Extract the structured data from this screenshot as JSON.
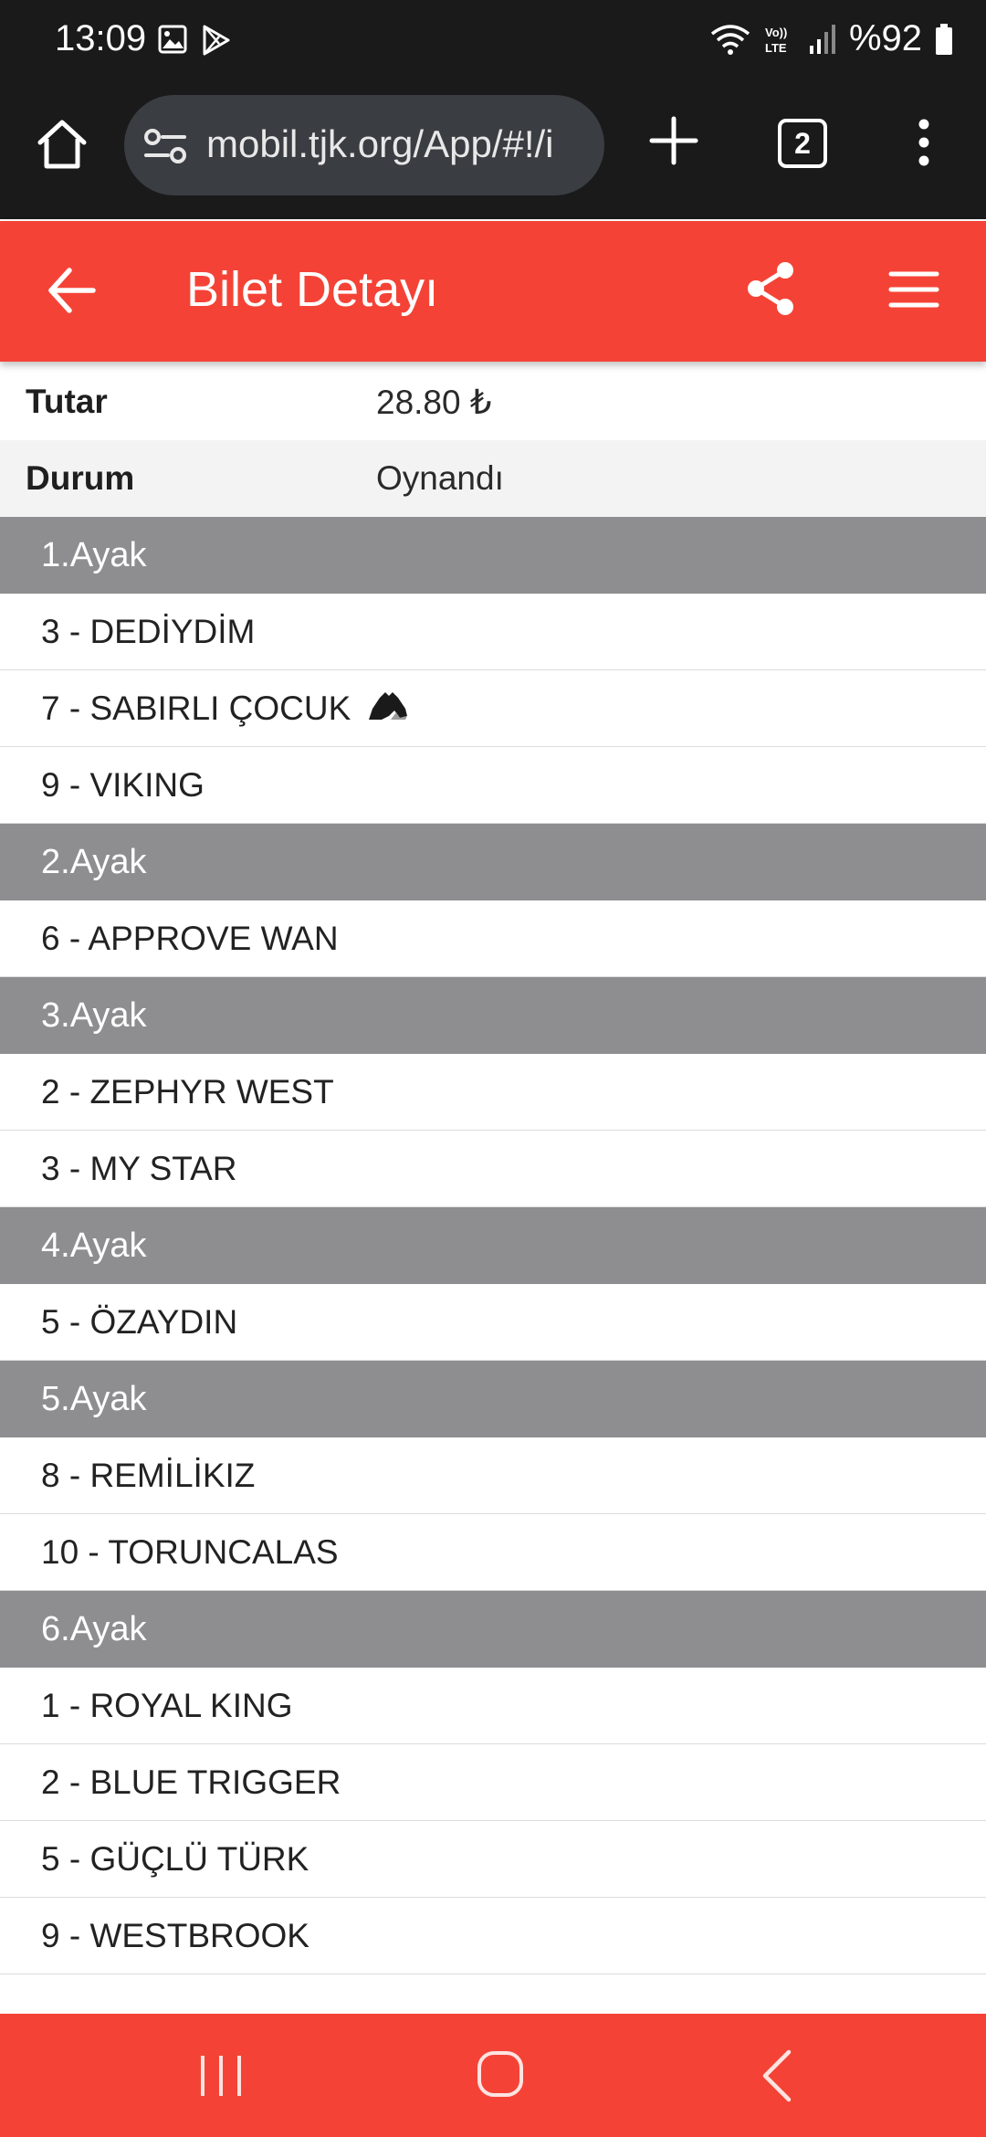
{
  "status_bar": {
    "time": "13:09",
    "battery": "%92"
  },
  "browser": {
    "url": "mobil.tjk.org/App/#!/i",
    "tab_count": "2"
  },
  "header": {
    "title": "Bilet Detayı"
  },
  "info": {
    "amount_label": "Tutar",
    "amount_value": "28.80 ₺",
    "status_label": "Durum",
    "status_value": "Oynandı"
  },
  "legs": [
    {
      "label": "1.Ayak",
      "horses": [
        "3 - DEDİYDİM",
        "7 - SABIRLI ÇOCUK",
        "9 - VIKING"
      ]
    },
    {
      "label": "2.Ayak",
      "horses": [
        "6 - APPROVE WAN"
      ]
    },
    {
      "label": "3.Ayak",
      "horses": [
        "2 - ZEPHYR WEST",
        "3 - MY STAR"
      ]
    },
    {
      "label": "4.Ayak",
      "horses": [
        "5 - ÖZAYDIN"
      ]
    },
    {
      "label": "5.Ayak",
      "horses": [
        "8 - REMİLİKIZ",
        "10 - TORUNCALAS"
      ]
    },
    {
      "label": "6.Ayak",
      "horses": [
        "1 - ROYAL KING",
        "2 - BLUE TRIGGER",
        "5 - GÜÇLÜ TÜRK",
        "9 - WESTBROOK"
      ]
    }
  ],
  "icons": {
    "status_bar": [
      "gallery-icon",
      "play-store-icon",
      "wifi-icon",
      "volte-icon",
      "signal-icon",
      "battery-icon"
    ],
    "browser": [
      "home-icon",
      "site-settings-icon",
      "plus-icon",
      "tab-switcher-icon",
      "more-vert-icon"
    ],
    "header": [
      "arrow-back-icon",
      "share-icon",
      "hamburger-menu-icon"
    ],
    "row": [
      "horse-head-icon"
    ],
    "nav": [
      "recents-icon",
      "home-circle-icon",
      "back-chevron-icon"
    ]
  },
  "colors": {
    "accent": "#f44336",
    "leg_header": "#8e8d8f",
    "system_bar": "#1a1a1a"
  }
}
